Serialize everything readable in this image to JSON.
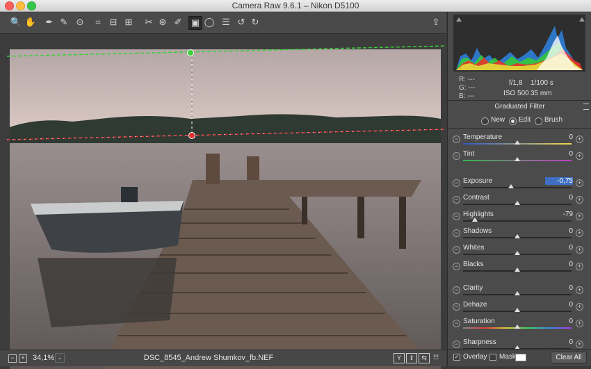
{
  "window": {
    "title": "Camera Raw 9.6.1  –  Nikon D5100"
  },
  "toolbar": {
    "tools": [
      {
        "icon": "zoom-icon",
        "glyph": "🔍"
      },
      {
        "icon": "hand-icon",
        "glyph": "✋"
      },
      {
        "icon": "white-balance-icon",
        "glyph": "✒"
      },
      {
        "icon": "color-sampler-icon",
        "glyph": "✎"
      },
      {
        "icon": "target-adjustment-icon",
        "glyph": "⊙"
      },
      {
        "icon": "crop-icon",
        "glyph": "⌗"
      },
      {
        "icon": "straighten-icon",
        "glyph": "⊟"
      },
      {
        "icon": "transform-icon",
        "glyph": "⊞"
      },
      {
        "icon": "spot-removal-icon",
        "glyph": "✂"
      },
      {
        "icon": "red-eye-icon",
        "glyph": "⊛"
      },
      {
        "icon": "adjustment-brush-icon",
        "glyph": "✐"
      },
      {
        "icon": "graduated-filter-icon",
        "glyph": "▣"
      },
      {
        "icon": "radial-filter-icon",
        "glyph": "◯"
      },
      {
        "icon": "preferences-icon",
        "glyph": "☰"
      },
      {
        "icon": "rotate-ccw-icon",
        "glyph": "↺"
      },
      {
        "icon": "rotate-cw-icon",
        "glyph": "↻"
      }
    ],
    "export_icon": "⇪"
  },
  "status": {
    "zoom": "34,1%",
    "filename": "DSC_8545_Andrew Shumkov_fb.NEF",
    "view_buttons": [
      "Y",
      "⇕",
      "⇆",
      "☷"
    ]
  },
  "histogram": {
    "r_label": "R:",
    "r_value": "---",
    "g_label": "G:",
    "g_value": "---",
    "b_label": "B:",
    "b_value": "---",
    "aperture": "f/1,8",
    "shutter": "1/100 s",
    "iso": "ISO 500",
    "focal": "35 mm"
  },
  "filter_panel": {
    "title": "Graduated Filter",
    "modes": [
      {
        "label": "New",
        "checked": false
      },
      {
        "label": "Edit",
        "checked": true
      },
      {
        "label": "Brush",
        "checked": false
      }
    ],
    "sliders": [
      {
        "label": "Temperature",
        "value": "0",
        "level": 0.5,
        "track": "temp"
      },
      {
        "label": "Tint",
        "value": "0",
        "level": 0.5,
        "track": "tint"
      },
      {
        "label": "Exposure",
        "value": "-0,75",
        "level": 0.44,
        "track": "dark",
        "selected": true
      },
      {
        "label": "Contrast",
        "value": "0",
        "level": 0.5,
        "track": "dark"
      },
      {
        "label": "Highlights",
        "value": "-79",
        "level": 0.11,
        "track": "dark"
      },
      {
        "label": "Shadows",
        "value": "0",
        "level": 0.5,
        "track": "dark"
      },
      {
        "label": "Whites",
        "value": "0",
        "level": 0.5,
        "track": "dark"
      },
      {
        "label": "Blacks",
        "value": "0",
        "level": 0.5,
        "track": "dark"
      },
      {
        "label": "Clarity",
        "value": "0",
        "level": 0.5,
        "track": "dark"
      },
      {
        "label": "Dehaze",
        "value": "0",
        "level": 0.5,
        "track": "dark"
      },
      {
        "label": "Saturation",
        "value": "0",
        "level": 0.5,
        "track": "sat"
      },
      {
        "label": "Sharpness",
        "value": "0",
        "level": 0.5,
        "track": "dark"
      }
    ]
  },
  "bottom": {
    "overlay_label": "Overlay",
    "overlay_checked": true,
    "mask_label": "Mask",
    "mask_checked": false,
    "clear_label": "Clear All"
  },
  "colors": {
    "filter_line_green": "#3ccf3c",
    "filter_line_red": "#e03030",
    "selection": "#3e6fc4"
  }
}
